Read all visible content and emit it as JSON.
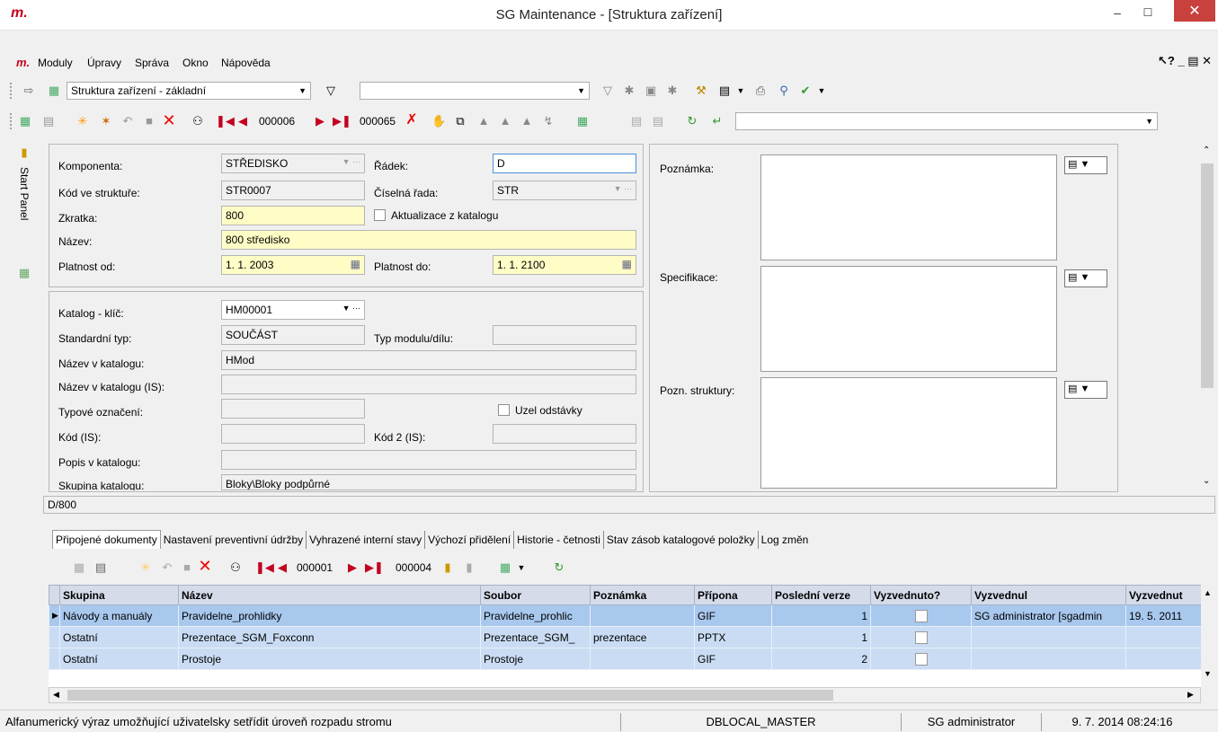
{
  "window": {
    "title": "SG Maintenance - [Struktura zařízení]",
    "logo": "m."
  },
  "menu": {
    "logo": "m.",
    "items": [
      "Moduly",
      "Úpravy",
      "Správa",
      "Okno",
      "Nápověda"
    ]
  },
  "toolbar1": {
    "view_select": "Struktura zařízení - základní",
    "filter_value": ""
  },
  "toolbar2": {
    "current_record": "000006",
    "total_records": "000065"
  },
  "side": {
    "start_panel": "Start Panel"
  },
  "form": {
    "komponenta_label": "Komponenta:",
    "komponenta": "STŘEDISKO",
    "radek_label": "Řádek:",
    "radek": "D",
    "kod_label": "Kód ve struktuře:",
    "kod": "STR0007",
    "ciselna_label": "Číselná řada:",
    "ciselna": "STR",
    "zkratka_label": "Zkratka:",
    "zkratka": "800",
    "aktualizace_label": "Aktualizace z katalogu",
    "nazev_label": "Název:",
    "nazev": "800 středisko",
    "platnost_od_label": "Platnost od:",
    "platnost_od": "1. 1. 2003",
    "platnost_do_label": "Platnost do:",
    "platnost_do": "1. 1. 2100",
    "katalog_label": "Katalog - klíč:",
    "katalog": "HM00001",
    "std_typ_label": "Standardní typ:",
    "std_typ": "SOUČÁST",
    "typ_modulu_label": "Typ modulu/dílu:",
    "typ_modulu": "",
    "nazev_kat_label": "Název v katalogu:",
    "nazev_kat": "HMod",
    "nazev_kat_is_label": "Název v katalogu (IS):",
    "nazev_kat_is": "",
    "typove_label": "Typové označení:",
    "typove": "",
    "uzel_label": "Uzel odstávky",
    "kod_is_label": "Kód (IS):",
    "kod_is": "",
    "kod2_label": "Kód 2 (IS):",
    "kod2": "",
    "popis_label": "Popis v katalogu:",
    "popis": "",
    "skupina_label": "Skupina katalogu:",
    "skupina": "Bloky\\Bloky podpůrné",
    "poznamka_label": "Poznámka:",
    "specifikace_label": "Specifikace:",
    "pozn_struktury_label": "Pozn. struktury:"
  },
  "path": "D/800",
  "tabs": [
    "Připojené dokumenty",
    "Nastavení preventivní údržby",
    "Vyhrazené interní stavy",
    "Výchozí přidělení",
    "Historie - četnosti",
    "Stav zásob katalogové položky",
    "Log změn"
  ],
  "grid_toolbar": {
    "current_record": "000001",
    "total_records": "000004"
  },
  "grid": {
    "columns": [
      "Skupina",
      "Název",
      "Soubor",
      "Poznámka",
      "Přípona",
      "Poslední verze",
      "Vyzvednuto?",
      "Vyzvednul",
      "Vyzvednut"
    ],
    "rows": [
      {
        "skupina": "Návody a manuály",
        "nazev": "Pravidelne_prohlidky",
        "soubor": "Pravidelne_prohlic",
        "poznamka": "",
        "pripona": "GIF",
        "verze": "1",
        "vyzvednul": "SG administrator [sgadmin",
        "vyzvednuto_dne": "19. 5. 2011"
      },
      {
        "skupina": "Ostatní",
        "nazev": "Prezentace_SGM_Foxconn",
        "soubor": "Prezentace_SGM_",
        "poznamka": "prezentace",
        "pripona": "PPTX",
        "verze": "1",
        "vyzvednul": "",
        "vyzvednuto_dne": ""
      },
      {
        "skupina": "Ostatní",
        "nazev": "Prostoje",
        "soubor": "Prostoje",
        "poznamka": "",
        "pripona": "GIF",
        "verze": "2",
        "vyzvednul": "",
        "vyzvednuto_dne": ""
      }
    ]
  },
  "status": {
    "hint": "Alfanumerický výraz umožňující uživatelsky setřídit úroveň rozpadu stromu",
    "db": "DBLOCAL_MASTER",
    "user": "SG administrator",
    "datetime": "9. 7. 2014 08:24:16"
  }
}
